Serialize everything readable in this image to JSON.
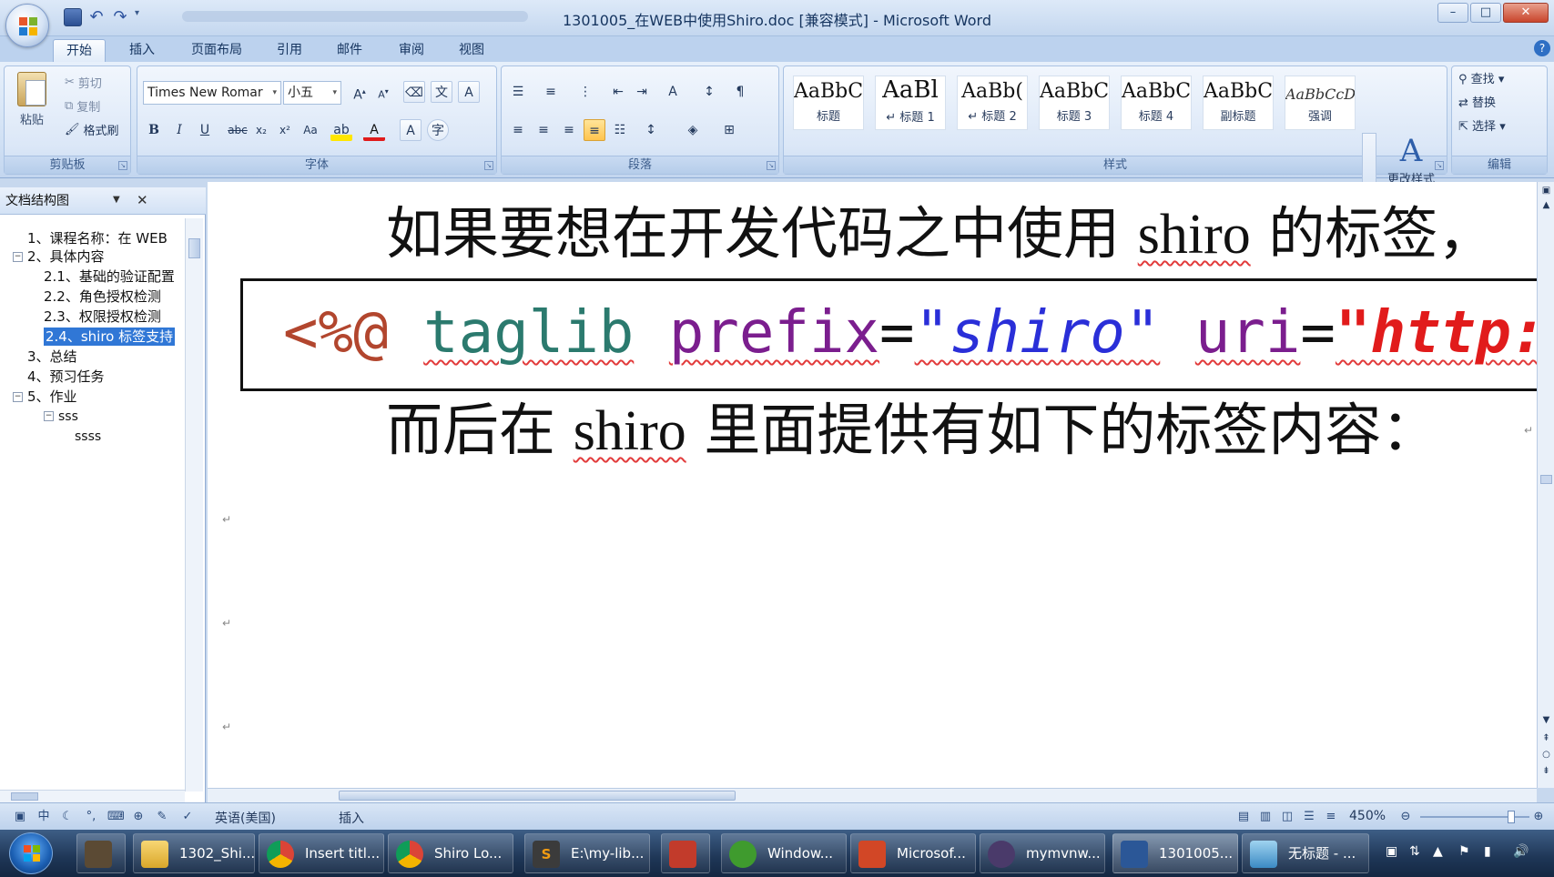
{
  "window": {
    "title": "1301005_在WEB中使用Shiro.doc [兼容模式] - Microsoft Word",
    "minimize": "–",
    "maximize": "□",
    "close": "✕"
  },
  "ribbon_tabs": [
    "开始",
    "插入",
    "页面布局",
    "引用",
    "邮件",
    "审阅",
    "视图"
  ],
  "clipboard": {
    "paste": "粘贴",
    "cut": "剪切",
    "copy": "复制",
    "format_painter": "格式刷",
    "label": "剪贴板"
  },
  "font": {
    "family": "Times New Romar",
    "size": "小五",
    "label": "字体"
  },
  "paragraph": {
    "label": "段落"
  },
  "styles": {
    "label": "样式",
    "tiles": [
      {
        "sample": "AaBbC",
        "name": "标题"
      },
      {
        "sample": "AaBl",
        "name": "↵ 标题 1"
      },
      {
        "sample": "AaBb(",
        "name": "↵ 标题 2"
      },
      {
        "sample": "AaBbC",
        "name": "标题 3"
      },
      {
        "sample": "AaBbC",
        "name": "标题 4"
      },
      {
        "sample": "AaBbC",
        "name": "副标题"
      },
      {
        "sample": "AaBbCcD",
        "name": "强调"
      }
    ],
    "change_styles": "更改样式"
  },
  "editing": {
    "find": "查找",
    "replace": "替换",
    "select": "选择",
    "label": "编辑"
  },
  "nav_pane": {
    "view": "文档结构图",
    "items": [
      "1、课程名称：在 WEB",
      "2、具体内容",
      "2.1、基础的验证配置",
      "2.2、角色授权检测",
      "2.3、权限授权检测",
      "2.4、shiro 标签支持",
      "3、总结",
      "4、预习任务",
      "5、作业",
      "sss",
      "ssss"
    ]
  },
  "document": {
    "line1_a": "如果要想在开发代码之中使用 ",
    "line1_b": "shiro",
    "line1_c": " 的标签，",
    "code": {
      "directive": "<%@",
      "taglib": "taglib",
      "prefix": "prefix",
      "eq": "=",
      "prefix_val": "\"shiro\"",
      "uri": "uri",
      "uri_val": "\"http:/"
    },
    "line3_a": "而后在 ",
    "line3_b": "shiro",
    "line3_c": " 里面提供有如下的标签内容：",
    "para_mark": "↵"
  },
  "statusbar": {
    "language": "英语(美国)",
    "mode": "插入",
    "zoom": "450%"
  },
  "taskbar": {
    "items": [
      "1302_Shi...",
      "Insert titl...",
      "Shiro Lo...",
      "E:\\my-lib...",
      "Window...",
      "Microsof...",
      "mymvnw...",
      "1301005...",
      "无标题 - ..."
    ]
  },
  "colors": {
    "accent": "#3077d6",
    "code_directive": "#b2462e",
    "code_tag": "#2b7a6e",
    "code_attr": "#7b1e8e",
    "code_string": "#2a2fd8",
    "code_url": "#e11b1b"
  }
}
